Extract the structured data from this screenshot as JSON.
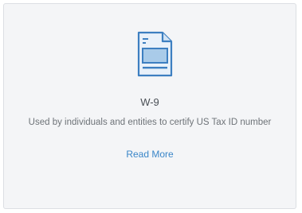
{
  "card": {
    "icon": "document-form-icon",
    "title": "W-9",
    "description": "Used by individuals and entities to certify US Tax ID number",
    "link_label": "Read More"
  },
  "colors": {
    "accent": "#3a86c8",
    "card_background": "#f4f5f7",
    "border": "#dcdfe3"
  }
}
